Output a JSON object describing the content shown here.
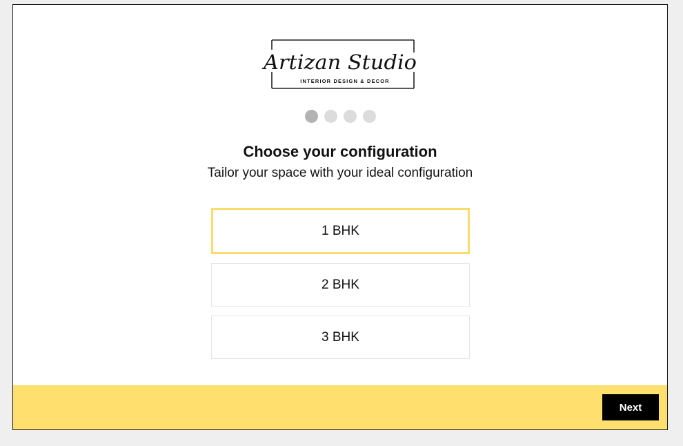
{
  "brand": {
    "name": "Artizan Studio",
    "tagline": "INTERIOR DESIGN & DECOR"
  },
  "progress": {
    "total_steps": 4,
    "current_step": 1
  },
  "heading": {
    "title": "Choose your configuration",
    "subtitle": "Tailor your space with your ideal configuration"
  },
  "options": [
    {
      "label": "1 BHK",
      "selected": true
    },
    {
      "label": "2 BHK",
      "selected": false
    },
    {
      "label": "3 BHK",
      "selected": false
    }
  ],
  "footer": {
    "next_label": "Next"
  },
  "colors": {
    "accent": "#ffdf6d",
    "selected_border": "#fbdc6b",
    "button_bg": "#000000",
    "dot_active": "#b3b3b3",
    "dot_inactive": "#dcdcdc"
  }
}
